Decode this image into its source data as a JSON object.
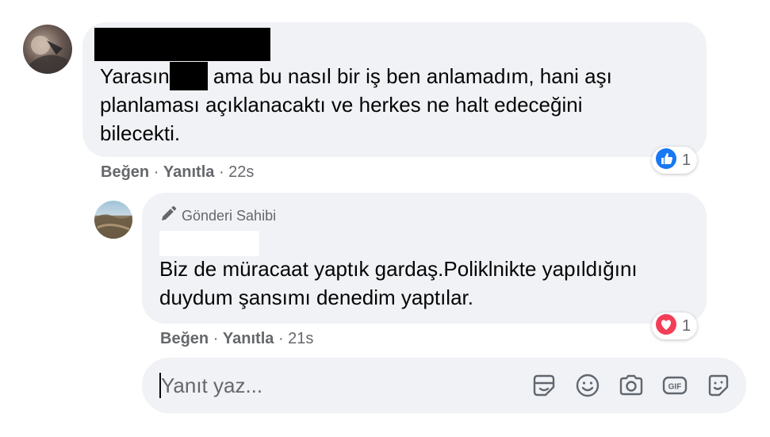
{
  "comment": {
    "text_before": "Yarasın",
    "text_after": "ama bu nasıl bir iş ben anlamadım, hani aşı",
    "line2": "planlaması açıklanacaktı ve herkes ne halt edeceğini",
    "line3": "bilecekti.",
    "like_label": "Beğen",
    "reply_label": "Yanıtla",
    "time": "22s",
    "reaction": {
      "icon": "like-icon",
      "count": "1",
      "color": "#1877f2"
    }
  },
  "reply": {
    "author_badge": "Gönderi Sahibi",
    "line1": "Biz de müracaat yaptık gardaş.Poliklnikte yapıldığını",
    "line2": "duydum şansımı denedim yaptılar.",
    "like_label": "Beğen",
    "reply_label": "Yanıtla",
    "time": "21s",
    "reaction": {
      "icon": "love-icon",
      "count": "1",
      "color": "#f33e58"
    }
  },
  "composer": {
    "placeholder": "Yanıt yaz...",
    "tools": [
      "sticker-icon",
      "emoji-icon",
      "camera-icon",
      "gif-icon",
      "avatar-sticker-icon"
    ]
  },
  "colors": {
    "bubble": "#f0f2f5",
    "secondary_text": "#65676b",
    "like_blue": "#1877f2",
    "love_red": "#f33e58"
  }
}
